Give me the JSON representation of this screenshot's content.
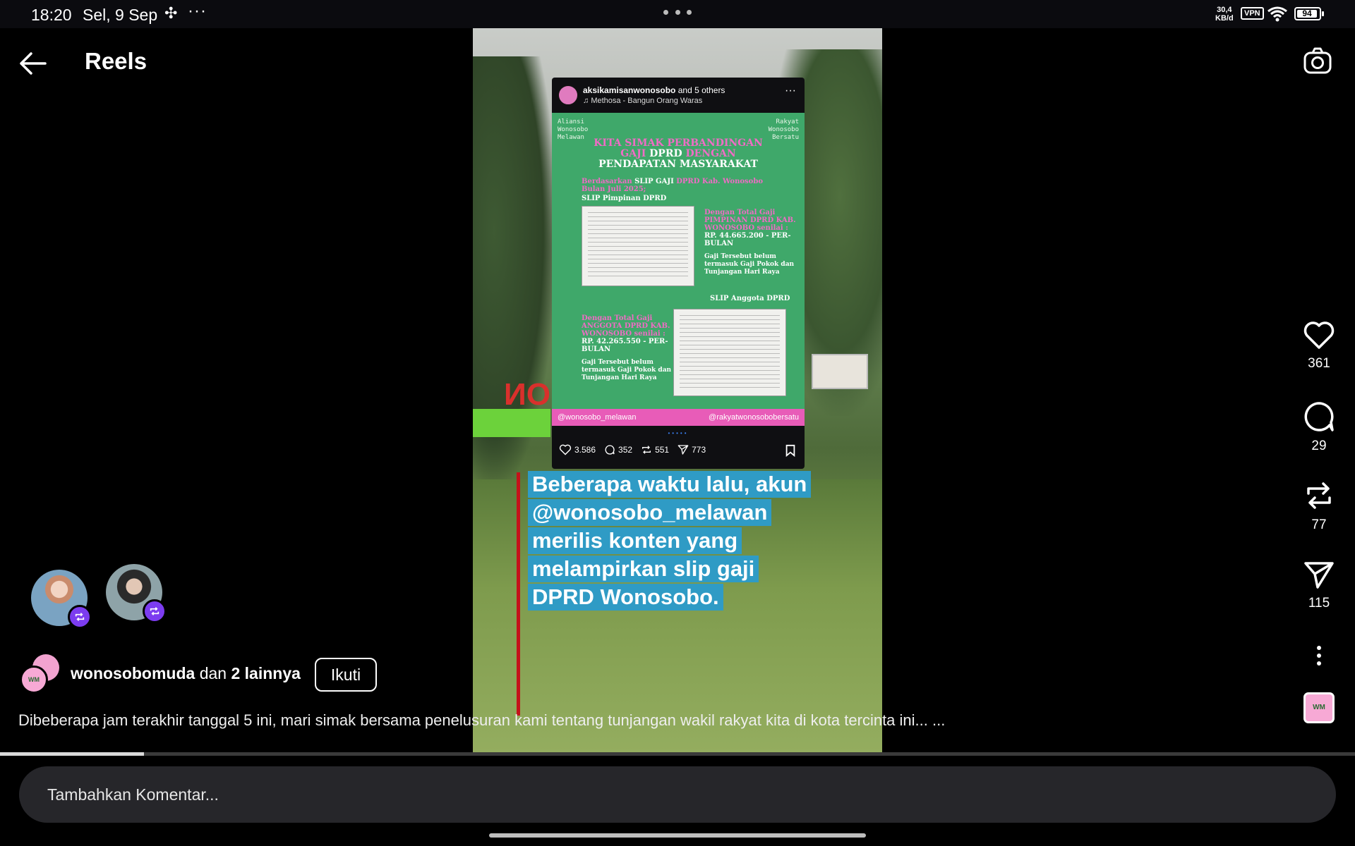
{
  "status_bar": {
    "time": "18:20",
    "date": "Sel, 9 Sep",
    "speed_top": "30,4",
    "speed_bottom": "KB/d",
    "vpn": "VPN",
    "battery": "94"
  },
  "header": {
    "title": "Reels"
  },
  "post": {
    "user": "aksikamisanwonosobo",
    "user_suffix": "and 5 others",
    "music": "Methosa - Bangun Orang Waras",
    "corner_left": "Aliansi Wonosobo Melawan",
    "corner_right": "Rakyat Wonosobo Bersatu",
    "heading_line1": "KITA SIMAK PERBANDINGAN",
    "heading_line2_a": "GAJI",
    "heading_line2_b": "DPRD",
    "heading_line2_c": "DENGAN",
    "heading_line3": "PENDAPATAN MASYARAKAT",
    "sub_a": "Berdasarkan",
    "sub_b": "SLIP GAJI",
    "sub_c": "DPRD Kab. Wonosobo Bulan Juli 2025;",
    "slip_label_1": "SLIP Pimpinan DPRD",
    "total_1_pink": "Dengan Total Gaji PIMPINAN DPRD KAB. WONOSOBO senilai :",
    "total_1_value": "RP. 44.665.200 - PER-BULAN",
    "note_1": "Gaji Tersebut belum termasuk Gaji Pokok dan Tunjangan Hari Raya",
    "slip_label_2": "SLIP Anggota DPRD",
    "total_2_pink": "Dengan Total Gaji ANGGOTA DPRD KAB. WONOSOBO senilai :",
    "total_2_value": "RP. 42.265.550 - PER-BULAN",
    "note_2": "Gaji Tersebut belum termasuk Gaji Pokok dan Tunjangan Hari Raya",
    "footer_left": "@wonosobo_melawan",
    "footer_right": "@rakyatwonosobobersatu",
    "likes": "3.586",
    "comments": "352",
    "reposts": "551",
    "shares": "773"
  },
  "caption_lines": [
    "Beberapa waktu lalu, akun",
    "@wonosobo_melawan",
    "merilis konten yang",
    "melampirkan slip gaji",
    "DPRD Wonosobo."
  ],
  "actions": {
    "likes": "361",
    "comments": "29",
    "reposts": "77",
    "shares": "115"
  },
  "author": {
    "name": "wonosobomuda",
    "connector": "dan",
    "others": "2 lainnya",
    "follow_label": "Ikuti",
    "avatar_text": "WM"
  },
  "description": "Dibeberapa jam terakhir tanggal 5 ini, mari simak bersama penelusuran kami tentang tunjangan wakil rakyat kita di kota tercinta ini... ...",
  "progress": 0.106,
  "comment": {
    "placeholder": "Tambahkan Komentar..."
  },
  "colors": {
    "caption_bg": "#2f9bc5",
    "post_green": "#3fa86a",
    "post_pink": "#e85cb8",
    "repost_badge": "#7c3cf0"
  }
}
